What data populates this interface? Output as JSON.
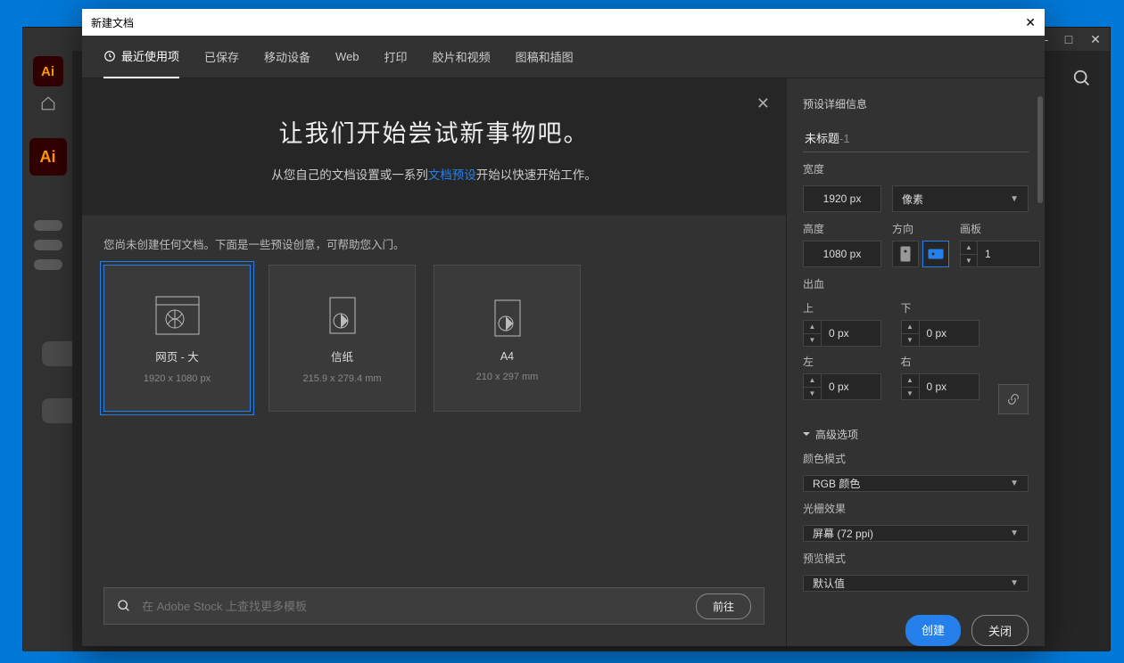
{
  "host": {
    "min": "—",
    "max": "□",
    "close": "✕"
  },
  "dialog": {
    "title": "新建文档",
    "tabs": [
      "最近使用项",
      "已保存",
      "移动设备",
      "Web",
      "打印",
      "胶片和视频",
      "图稿和插图"
    ],
    "intro": {
      "heading": "让我们开始尝试新事物吧。",
      "text_a": "从您自己的文档设置或一系列",
      "text_link": "文档预设",
      "text_b": "开始以快速开始工作。"
    },
    "hint": "您尚未创建任何文档。下面是一些预设创意，可帮助您入门。",
    "cards": [
      {
        "title": "网页 - 大",
        "dim": "1920 x 1080 px"
      },
      {
        "title": "信纸",
        "dim": "215.9 x 279.4 mm"
      },
      {
        "title": "A4",
        "dim": "210 x 297 mm"
      }
    ],
    "search": {
      "placeholder": "在 Adobe Stock 上查找更多模板",
      "go": "前往"
    }
  },
  "panel": {
    "heading": "预设详细信息",
    "title_base": "未标题",
    "title_suffix": "-1",
    "width_label": "宽度",
    "width": "1920 px",
    "units": "像素",
    "height_label": "高度",
    "height": "1080 px",
    "orient_label": "方向",
    "artboards_label": "画板",
    "artboards": "1",
    "bleed_label": "出血",
    "top_label": "上",
    "bottom_label": "下",
    "left_label": "左",
    "right_label": "右",
    "top": "0 px",
    "bottom": "0 px",
    "left": "0 px",
    "right": "0 px",
    "advanced": "高级选项",
    "color_label": "颜色模式",
    "color": "RGB 颜色",
    "raster_label": "光栅效果",
    "raster": "屏幕 (72 ppi)",
    "preview_label": "预览模式",
    "preview": "默认值",
    "create": "创建",
    "close": "关闭"
  }
}
